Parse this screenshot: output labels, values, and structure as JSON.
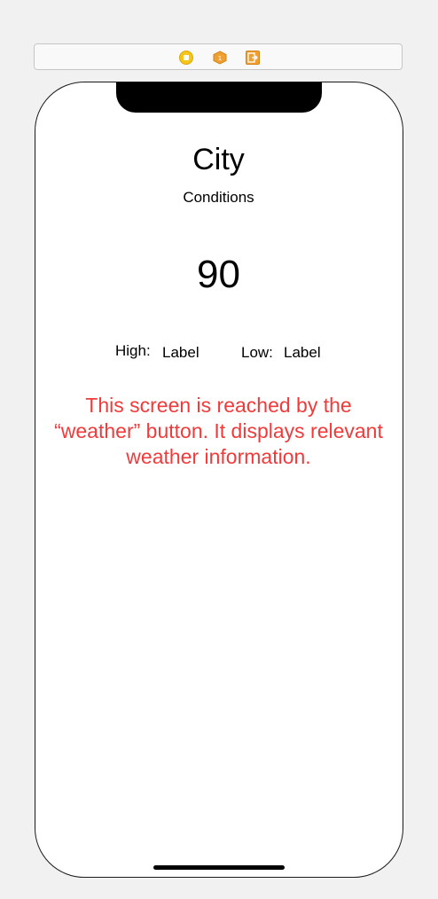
{
  "toolbar": {
    "icons": [
      "view-controller-icon",
      "first-responder-icon",
      "exit-icon"
    ],
    "colors": {
      "view_controller": "#f5c518",
      "first_responder": "#f0a030",
      "exit": "#f0a030"
    }
  },
  "screen": {
    "city": "City",
    "conditions": "Conditions",
    "temperature": "90",
    "high_label": "High:",
    "high_value": "Label",
    "low_label": "Low:",
    "low_value": "Label"
  },
  "annotation": {
    "text": "This screen is reached by the\n“weather” button. It displays relevant\nweather information.",
    "color": "#f23a3a"
  }
}
